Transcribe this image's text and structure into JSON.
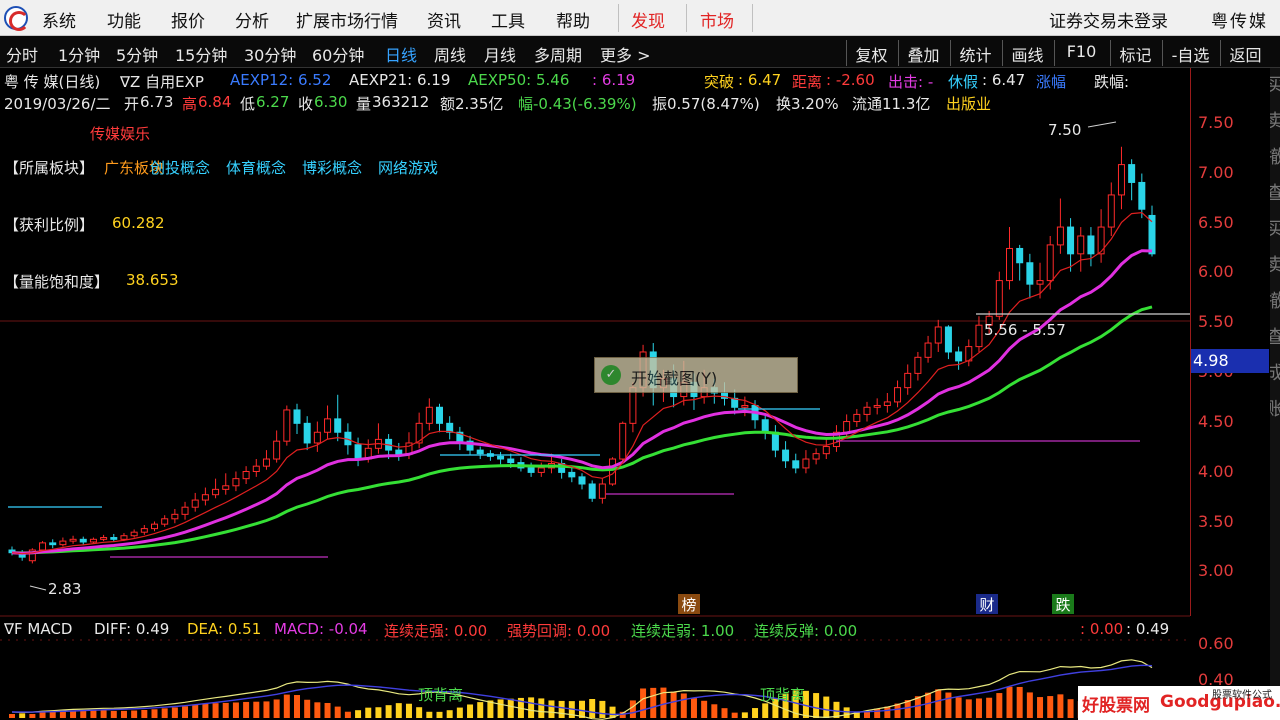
{
  "menu": {
    "items": [
      "系统",
      "功能",
      "报价",
      "分析",
      "扩展市场行情",
      "资讯",
      "工具",
      "帮助"
    ],
    "highlight": [
      "发现",
      "市场"
    ],
    "account_status": "证券交易未登录",
    "stock_name": "粤传媒"
  },
  "periods": [
    "分时",
    "1分钟",
    "5分钟",
    "15分钟",
    "30分钟",
    "60分钟",
    "日线",
    "周线",
    "月线",
    "多周期",
    "更多 >"
  ],
  "active_period": "日线",
  "tools": [
    "复权",
    "叠加",
    "统计",
    "画线",
    "F10",
    "标记",
    "-自选",
    "返回"
  ],
  "info1": {
    "name": "粤 传 媒(日线)",
    "indicator": "∇Z 自用EXP",
    "aexp12": "AEXP12: 6.52",
    "aexp21": "AEXP21: 6.19",
    "aexp50": "AEXP50: 5.46",
    "extra": ": 6.19",
    "tupo_label": "突破",
    "tupo_value": ": 6.47",
    "juli_label": "距离",
    "juli_value": ": -2.60",
    "chuji": "出击: -",
    "xiujia_label": "休假",
    "xiujia_value": ": 6.47",
    "zhangfu": "涨幅",
    "diefu": "跌幅:"
  },
  "info2": {
    "date": "2019/03/26/二",
    "open_label": "开",
    "open": "6.73",
    "high_label": "高",
    "high": "6.84",
    "low_label": "低",
    "low": "6.27",
    "close_label": "收",
    "close": "6.30",
    "vol_label": "量",
    "vol": "363212",
    "amount": "额2.35亿",
    "change": "幅-0.43(-6.39%)",
    "amplitude": "振0.57(8.47%)",
    "turnover": "换3.20%",
    "float_cap": "流通11.3亿",
    "industry": "出版业"
  },
  "overlay": {
    "category": "传媒娱乐",
    "sector_label": "【所属板块】",
    "sectors": [
      "广东板块",
      "创投概念",
      "体育概念",
      "博彩概念",
      "网络游戏"
    ],
    "profit_label": "【获利比例】",
    "profit_value": "60.282",
    "vol_sat_label": "【量能饱和度】",
    "vol_sat_value": "38.653"
  },
  "price_axis": {
    "ticks": [
      "7.50",
      "7.00",
      "6.50",
      "6.00",
      "5.50",
      "5.00",
      "4.50",
      "4.00",
      "3.50",
      "3.00"
    ],
    "current_tag": "4.98"
  },
  "annotations": {
    "high_label": "7.50",
    "low_label": "2.83",
    "range_label": "5.56 - 5.57",
    "badge_bang": "榜",
    "badge_cai": "财",
    "badge_die": "跌"
  },
  "macd": {
    "title": "∇F MACD",
    "diff": "DIFF: 0.49",
    "dea": "DEA: 0.51",
    "macd": "MACD: -0.04",
    "s1": "连续走强: 0.00",
    "s2": "强势回调: 0.00",
    "s3": "连续走弱: 1.00",
    "s4": "连续反弹: 0.00",
    "r1": ": 0.00",
    "r2": ": 0.49",
    "ticks": [
      "0.60",
      "0.40"
    ],
    "divergence_label": "顶背离"
  },
  "popup": {
    "text": "开始截图(Y)"
  },
  "watermark": {
    "main": "好股票网",
    "site": "Goodgupiao.com",
    "small": "股票软件公式"
  },
  "chart_data": {
    "type": "candlestick",
    "ylim": [
      2.7,
      7.8
    ],
    "candles": [
      [
        2.98,
        2.95,
        3.02,
        2.92
      ],
      [
        2.95,
        2.9,
        2.98,
        2.86
      ],
      [
        2.86,
        2.98,
        3.0,
        2.83
      ],
      [
        2.98,
        3.06,
        3.08,
        2.96
      ],
      [
        3.06,
        3.04,
        3.1,
        3.0
      ],
      [
        3.04,
        3.08,
        3.12,
        3.02
      ],
      [
        3.08,
        3.1,
        3.14,
        3.05
      ],
      [
        3.1,
        3.07,
        3.13,
        3.04
      ],
      [
        3.07,
        3.1,
        3.12,
        3.05
      ],
      [
        3.1,
        3.12,
        3.15,
        3.08
      ],
      [
        3.12,
        3.1,
        3.16,
        3.07
      ],
      [
        3.1,
        3.14,
        3.17,
        3.08
      ],
      [
        3.14,
        3.18,
        3.21,
        3.12
      ],
      [
        3.18,
        3.22,
        3.26,
        3.15
      ],
      [
        3.22,
        3.27,
        3.3,
        3.19
      ],
      [
        3.27,
        3.33,
        3.37,
        3.24
      ],
      [
        3.33,
        3.38,
        3.44,
        3.28
      ],
      [
        3.38,
        3.46,
        3.52,
        3.32
      ],
      [
        3.46,
        3.54,
        3.62,
        3.41
      ],
      [
        3.54,
        3.6,
        3.68,
        3.48
      ],
      [
        3.6,
        3.66,
        3.78,
        3.56
      ],
      [
        3.66,
        3.7,
        3.84,
        3.6
      ],
      [
        3.7,
        3.78,
        3.86,
        3.64
      ],
      [
        3.78,
        3.86,
        3.92,
        3.72
      ],
      [
        3.86,
        3.92,
        4.0,
        3.8
      ],
      [
        3.92,
        4.0,
        4.1,
        3.88
      ],
      [
        4.0,
        4.2,
        4.32,
        3.96
      ],
      [
        4.2,
        4.55,
        4.6,
        4.15
      ],
      [
        4.55,
        4.4,
        4.62,
        4.28
      ],
      [
        4.4,
        4.18,
        4.48,
        4.1
      ],
      [
        4.18,
        4.3,
        4.42,
        4.08
      ],
      [
        4.3,
        4.45,
        4.6,
        4.22
      ],
      [
        4.45,
        4.3,
        4.72,
        4.2
      ],
      [
        4.3,
        4.16,
        4.4,
        4.05
      ],
      [
        4.16,
        4.0,
        4.24,
        3.92
      ],
      [
        4.0,
        4.12,
        4.22,
        3.96
      ],
      [
        4.12,
        4.22,
        4.4,
        4.06
      ],
      [
        4.22,
        4.1,
        4.28,
        4.0
      ],
      [
        4.1,
        4.05,
        4.18,
        3.98
      ],
      [
        4.05,
        4.18,
        4.3,
        4.0
      ],
      [
        4.18,
        4.4,
        4.52,
        4.12
      ],
      [
        4.4,
        4.58,
        4.68,
        4.32
      ],
      [
        4.58,
        4.4,
        4.62,
        4.3
      ],
      [
        4.4,
        4.3,
        4.48,
        4.22
      ],
      [
        4.3,
        4.2,
        4.36,
        4.1
      ],
      [
        4.2,
        4.1,
        4.26,
        4.04
      ],
      [
        4.1,
        4.06,
        4.14,
        4.0
      ],
      [
        4.06,
        4.03,
        4.1,
        3.98
      ],
      [
        4.03,
        4.0,
        4.08,
        3.94
      ],
      [
        4.0,
        3.96,
        4.06,
        3.9
      ],
      [
        3.96,
        3.9,
        4.02,
        3.86
      ],
      [
        3.9,
        3.85,
        3.96,
        3.8
      ],
      [
        3.85,
        3.9,
        3.96,
        3.8
      ],
      [
        3.9,
        3.95,
        4.06,
        3.84
      ],
      [
        3.95,
        3.85,
        4.0,
        3.78
      ],
      [
        3.85,
        3.8,
        3.9,
        3.74
      ],
      [
        3.8,
        3.72,
        3.84,
        3.66
      ],
      [
        3.72,
        3.56,
        3.76,
        3.52
      ],
      [
        3.56,
        3.72,
        3.78,
        3.5
      ],
      [
        3.72,
        4.0,
        4.02,
        3.7
      ],
      [
        4.0,
        4.4,
        4.42,
        3.98
      ],
      [
        4.4,
        4.8,
        4.86,
        4.3
      ],
      [
        4.8,
        5.2,
        5.28,
        4.7
      ],
      [
        5.2,
        4.8,
        5.3,
        4.6
      ],
      [
        4.8,
        4.9,
        5.0,
        4.64
      ],
      [
        4.9,
        4.7,
        5.06,
        4.58
      ],
      [
        4.7,
        4.86,
        5.1,
        4.6
      ],
      [
        4.86,
        4.7,
        4.96,
        4.55
      ],
      [
        4.7,
        4.8,
        5.0,
        4.62
      ],
      [
        4.8,
        4.74,
        4.9,
        4.62
      ],
      [
        4.74,
        4.68,
        4.86,
        4.6
      ],
      [
        4.68,
        4.58,
        4.78,
        4.5
      ],
      [
        4.58,
        4.6,
        4.7,
        4.48
      ],
      [
        4.6,
        4.44,
        4.66,
        4.34
      ],
      [
        4.44,
        4.3,
        4.5,
        4.22
      ],
      [
        4.3,
        4.1,
        4.38,
        4.02
      ],
      [
        4.1,
        3.98,
        4.2,
        3.9
      ],
      [
        3.98,
        3.9,
        4.06,
        3.84
      ],
      [
        3.9,
        4.0,
        4.1,
        3.84
      ],
      [
        4.0,
        4.06,
        4.12,
        3.94
      ],
      [
        4.06,
        4.14,
        4.22,
        4.0
      ],
      [
        4.14,
        4.3,
        4.38,
        4.08
      ],
      [
        4.3,
        4.42,
        4.5,
        4.24
      ],
      [
        4.42,
        4.5,
        4.56,
        4.36
      ],
      [
        4.5,
        4.58,
        4.64,
        4.42
      ],
      [
        4.58,
        4.6,
        4.68,
        4.5
      ],
      [
        4.6,
        4.64,
        4.74,
        4.52
      ],
      [
        4.64,
        4.8,
        4.88,
        4.58
      ],
      [
        4.8,
        4.96,
        5.06,
        4.72
      ],
      [
        4.96,
        5.14,
        5.2,
        4.88
      ],
      [
        5.14,
        5.3,
        5.38,
        5.08
      ],
      [
        5.3,
        5.48,
        5.56,
        5.2
      ],
      [
        5.48,
        5.2,
        5.5,
        5.12
      ],
      [
        5.2,
        5.1,
        5.26,
        5.0
      ],
      [
        5.1,
        5.26,
        5.34,
        5.04
      ],
      [
        5.26,
        5.5,
        5.6,
        5.2
      ],
      [
        5.5,
        5.6,
        5.66,
        5.4
      ],
      [
        5.6,
        6.0,
        6.1,
        5.56
      ],
      [
        6.0,
        6.36,
        6.6,
        5.9
      ],
      [
        6.36,
        6.2,
        6.4,
        6.0
      ],
      [
        6.2,
        5.96,
        6.3,
        5.8
      ],
      [
        5.96,
        6.0,
        6.2,
        5.8
      ],
      [
        6.0,
        6.4,
        6.5,
        5.9
      ],
      [
        6.4,
        6.6,
        6.92,
        6.3
      ],
      [
        6.6,
        6.3,
        6.7,
        6.1
      ],
      [
        6.3,
        6.5,
        6.6,
        6.1
      ],
      [
        6.5,
        6.3,
        6.6,
        6.16
      ],
      [
        6.3,
        6.6,
        6.8,
        6.2
      ],
      [
        6.6,
        6.96,
        7.1,
        6.5
      ],
      [
        6.96,
        7.3,
        7.5,
        6.8
      ],
      [
        7.3,
        7.1,
        7.36,
        6.9
      ],
      [
        7.1,
        6.8,
        7.2,
        6.7
      ],
      [
        6.73,
        6.3,
        6.84,
        6.27
      ]
    ]
  }
}
